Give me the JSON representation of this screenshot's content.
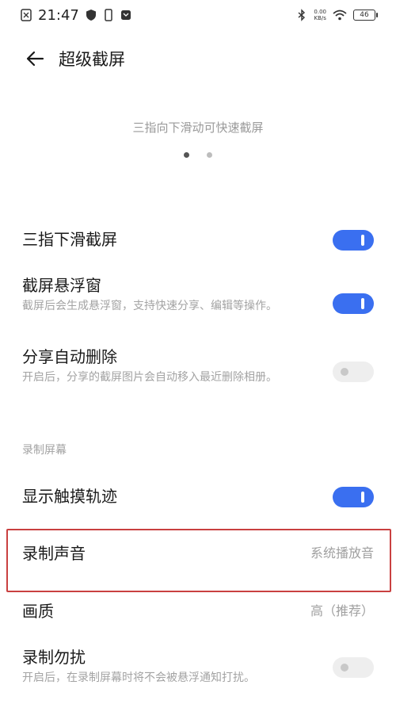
{
  "status_bar": {
    "time": "21:47",
    "net_speed_value": "0.00",
    "net_speed_unit": "KB/s",
    "battery_level": "46"
  },
  "header": {
    "title": "超级截屏"
  },
  "hint": {
    "text": "三指向下滑动可快速截屏",
    "page_count": 2,
    "active_page": 1
  },
  "settings": {
    "three_finger": {
      "title": "三指下滑截屏",
      "enabled": true
    },
    "floating_window": {
      "title": "截屏悬浮窗",
      "desc": "截屏后会生成悬浮窗，支持快速分享、编辑等操作。",
      "enabled": true
    },
    "auto_delete": {
      "title": "分享自动删除",
      "desc": "开启后，分享的截屏图片会自动移入最近删除相册。",
      "enabled": false
    },
    "section_record": "录制屏幕",
    "show_touch": {
      "title": "显示触摸轨迹",
      "enabled": true
    },
    "record_sound": {
      "title": "录制声音",
      "value": "系统播放音"
    },
    "quality": {
      "title": "画质",
      "value": "高（推荐）"
    },
    "dnd": {
      "title": "录制勿扰",
      "desc": "开启后，在录制屏幕时将不会被悬浮通知打扰。",
      "enabled": false
    }
  },
  "colors": {
    "accent": "#3a6ff0",
    "highlight": "#c94040"
  }
}
